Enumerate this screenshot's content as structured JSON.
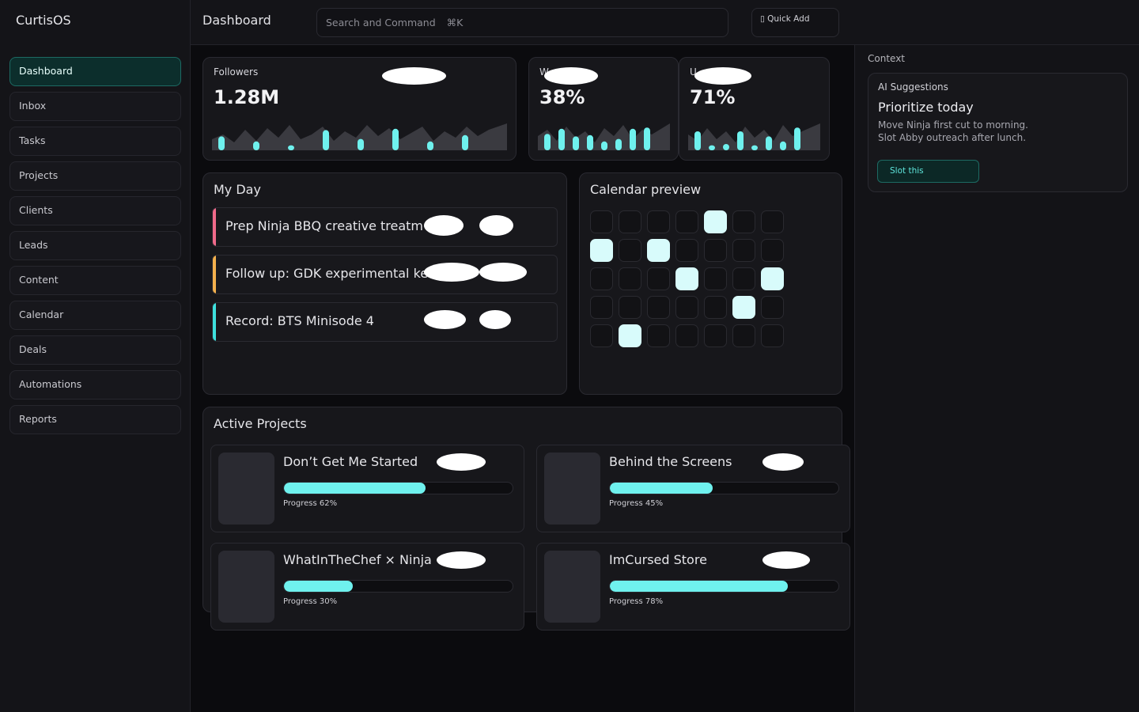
{
  "app": {
    "brand": "CurtisOS"
  },
  "sidebar": {
    "items": [
      {
        "label": "Dashboard",
        "active": true
      },
      {
        "label": "Inbox"
      },
      {
        "label": "Tasks"
      },
      {
        "label": "Projects"
      },
      {
        "label": "Clients"
      },
      {
        "label": "Leads"
      },
      {
        "label": "Content"
      },
      {
        "label": "Calendar"
      },
      {
        "label": "Deals"
      },
      {
        "label": "Automations"
      },
      {
        "label": "Reports"
      }
    ]
  },
  "topbar": {
    "title": "Dashboard",
    "search_placeholder": "Search and Command",
    "search_shortcut": "⌘K",
    "quick_add_icon": "plus-icon",
    "quick_add_label": "Quick Add"
  },
  "stats": [
    {
      "label": "Followers",
      "value": "1.28M",
      "bars": [
        0.55,
        0.35,
        0.2,
        0.8,
        0.45,
        0.85,
        0.35,
        0.6
      ]
    },
    {
      "label": "W",
      "value": "38%",
      "bars": [
        0.65,
        0.85,
        0.55,
        0.6,
        0.35,
        0.45,
        0.85,
        0.9
      ]
    },
    {
      "label": "U",
      "value": "71%",
      "bars": [
        0.75,
        0.2,
        0.25,
        0.75,
        0.2,
        0.55,
        0.35,
        0.9
      ]
    }
  ],
  "my_day": {
    "title": "My Day",
    "tasks": [
      {
        "text": "Prep Ninja BBQ creative treatm",
        "color": "#f06a8a"
      },
      {
        "text": "Follow up: GDK experimental ke",
        "color": "#f3b04d"
      },
      {
        "text": "Record: BTS Minisode 4",
        "color": "#3ee0dd"
      }
    ]
  },
  "calendar": {
    "title": "Calendar preview",
    "active_cells": [
      4,
      7,
      9,
      17,
      20,
      26,
      29
    ]
  },
  "projects": {
    "title": "Active Projects",
    "items": [
      {
        "name": "Don’t Get Me Started",
        "progress": 62,
        "progress_label": "Progress 62%"
      },
      {
        "name": "Behind the Screens",
        "progress": 45,
        "progress_label": "Progress 45%"
      },
      {
        "name": "WhatInTheChef × Ninja",
        "progress": 30,
        "progress_label": "Progress 30%"
      },
      {
        "name": "ImCursed Store",
        "progress": 78,
        "progress_label": "Progress 78%"
      }
    ]
  },
  "context": {
    "title": "Context",
    "ai": {
      "label": "AI Suggestions",
      "heading": "Prioritize today",
      "line1": "Move Ninja first cut to morning.",
      "line2": "Slot Abby outreach after lunch.",
      "button": "Slot this"
    }
  },
  "colors": {
    "accent": "#6ff1ee",
    "accent_dark": "#0c2e2c"
  }
}
